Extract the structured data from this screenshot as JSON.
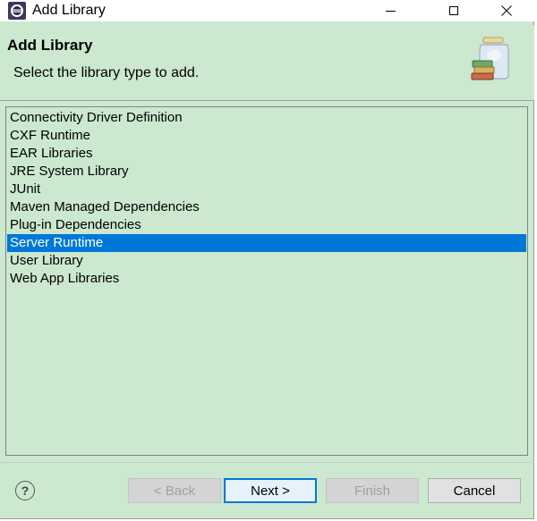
{
  "window": {
    "title": "Add Library",
    "icon": "eclipse-icon"
  },
  "header": {
    "title": "Add Library",
    "description": "Select the library type to add.",
    "graphic": "library-jar-icon"
  },
  "library_types": [
    "Connectivity Driver Definition",
    "CXF Runtime",
    "EAR Libraries",
    "JRE System Library",
    "JUnit",
    "Maven Managed Dependencies",
    "Plug-in Dependencies",
    "Server Runtime",
    "User Library",
    "Web App Libraries"
  ],
  "selected_library": "Server Runtime",
  "buttons": {
    "back": "< Back",
    "next": "Next >",
    "finish": "Finish",
    "cancel": "Cancel",
    "help": "?"
  },
  "colors": {
    "background": "#cce8cf",
    "selection": "#0078d7"
  }
}
